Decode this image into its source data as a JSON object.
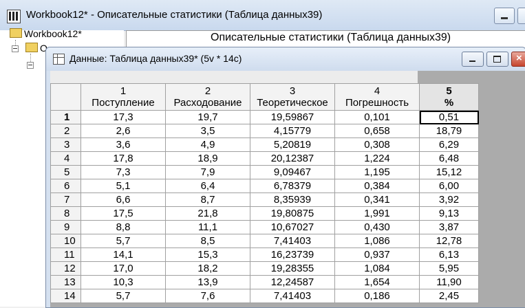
{
  "workbook": {
    "title": "Workbook12* - Описательные статистики (Таблица данных39)",
    "tree_root": "Workbook12*",
    "tree_child": "О",
    "output_header": "Описательные статистики (Таблица данных39)"
  },
  "data_window": {
    "title": "Данные: Таблица данных39* (5v * 14c)",
    "close_glyph": "×"
  },
  "table": {
    "columns": [
      {
        "num": "1",
        "name": "Поступление"
      },
      {
        "num": "2",
        "name": "Расходование"
      },
      {
        "num": "3",
        "name": "Теоретическое"
      },
      {
        "num": "4",
        "name": "Погрешность"
      },
      {
        "num": "5",
        "name": "%"
      }
    ],
    "rows": [
      {
        "n": "1",
        "v": [
          "17,3",
          "19,7",
          "19,59867",
          "0,101",
          "0,51"
        ]
      },
      {
        "n": "2",
        "v": [
          "2,6",
          "3,5",
          "4,15779",
          "0,658",
          "18,79"
        ]
      },
      {
        "n": "3",
        "v": [
          "3,6",
          "4,9",
          "5,20819",
          "0,308",
          "6,29"
        ]
      },
      {
        "n": "4",
        "v": [
          "17,8",
          "18,9",
          "20,12387",
          "1,224",
          "6,48"
        ]
      },
      {
        "n": "5",
        "v": [
          "7,3",
          "7,9",
          "9,09467",
          "1,195",
          "15,12"
        ]
      },
      {
        "n": "6",
        "v": [
          "5,1",
          "6,4",
          "6,78379",
          "0,384",
          "6,00"
        ]
      },
      {
        "n": "7",
        "v": [
          "6,6",
          "8,7",
          "8,35939",
          "0,341",
          "3,92"
        ]
      },
      {
        "n": "8",
        "v": [
          "17,5",
          "21,8",
          "19,80875",
          "1,991",
          "9,13"
        ]
      },
      {
        "n": "9",
        "v": [
          "8,8",
          "11,1",
          "10,67027",
          "0,430",
          "3,87"
        ]
      },
      {
        "n": "10",
        "v": [
          "5,7",
          "8,5",
          "7,41403",
          "1,086",
          "12,78"
        ]
      },
      {
        "n": "11",
        "v": [
          "14,1",
          "15,3",
          "16,23739",
          "0,937",
          "6,13"
        ]
      },
      {
        "n": "12",
        "v": [
          "17,0",
          "18,2",
          "19,28355",
          "1,084",
          "5,95"
        ]
      },
      {
        "n": "13",
        "v": [
          "10,3",
          "13,9",
          "12,24587",
          "1,654",
          "11,90"
        ]
      },
      {
        "n": "14",
        "v": [
          "5,7",
          "7,6",
          "7,41403",
          "0,186",
          "2,45"
        ]
      }
    ]
  }
}
